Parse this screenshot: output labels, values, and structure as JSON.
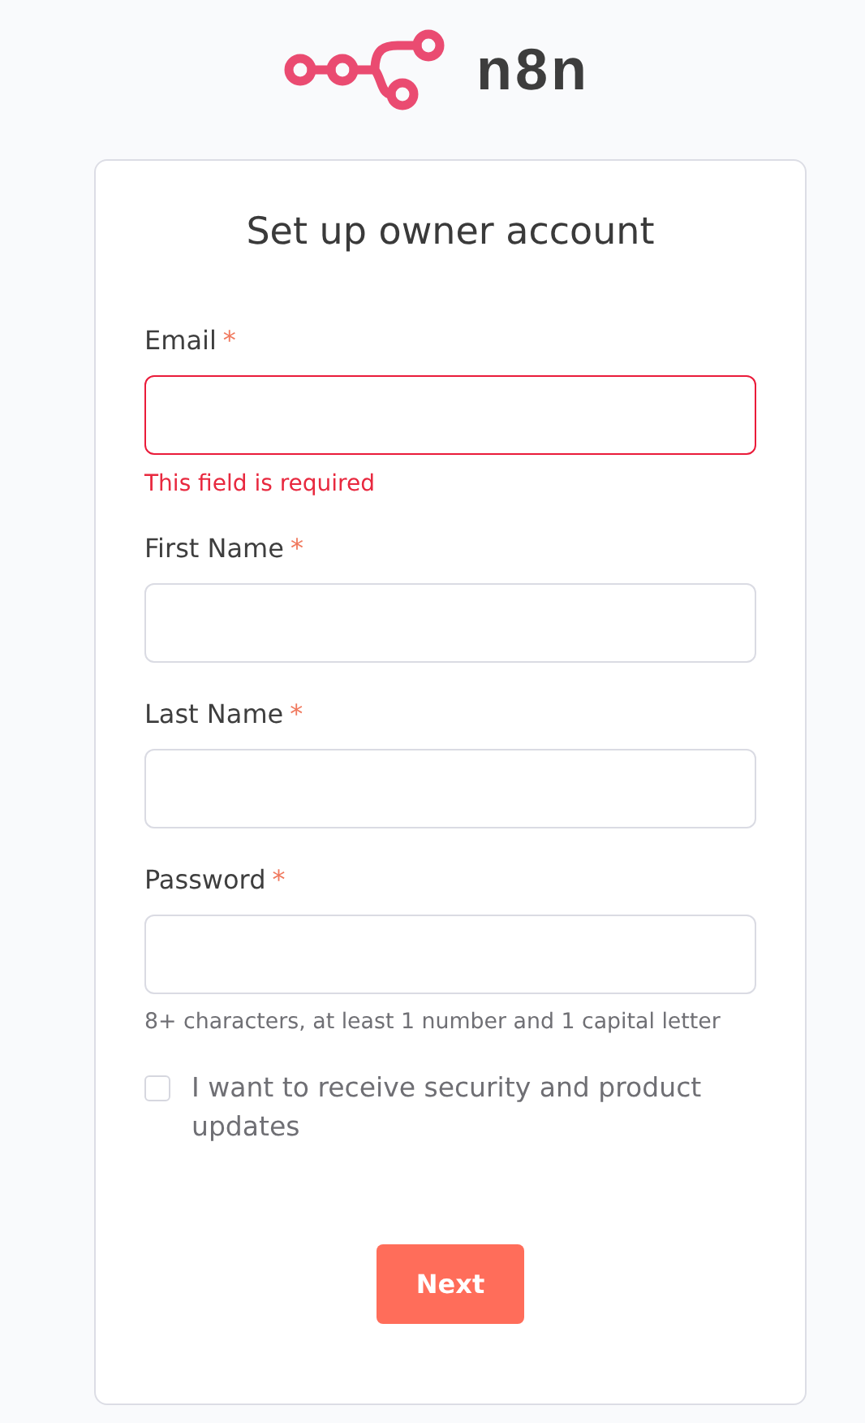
{
  "brand": {
    "name": "n8n"
  },
  "form": {
    "title": "Set up owner account",
    "fields": [
      {
        "label": "Email",
        "required_mark": "*",
        "invalid": true,
        "error": "This field is required"
      },
      {
        "label": "First Name",
        "required_mark": "*",
        "invalid": false
      },
      {
        "label": "Last Name",
        "required_mark": "*",
        "invalid": false
      },
      {
        "label": "Password",
        "required_mark": "*",
        "invalid": false,
        "hint": "8+ characters, at least 1 number and 1 capital letter"
      }
    ],
    "consent": {
      "label": "I want to receive security and product updates",
      "checked": false
    },
    "submit": {
      "label": "Next"
    }
  }
}
